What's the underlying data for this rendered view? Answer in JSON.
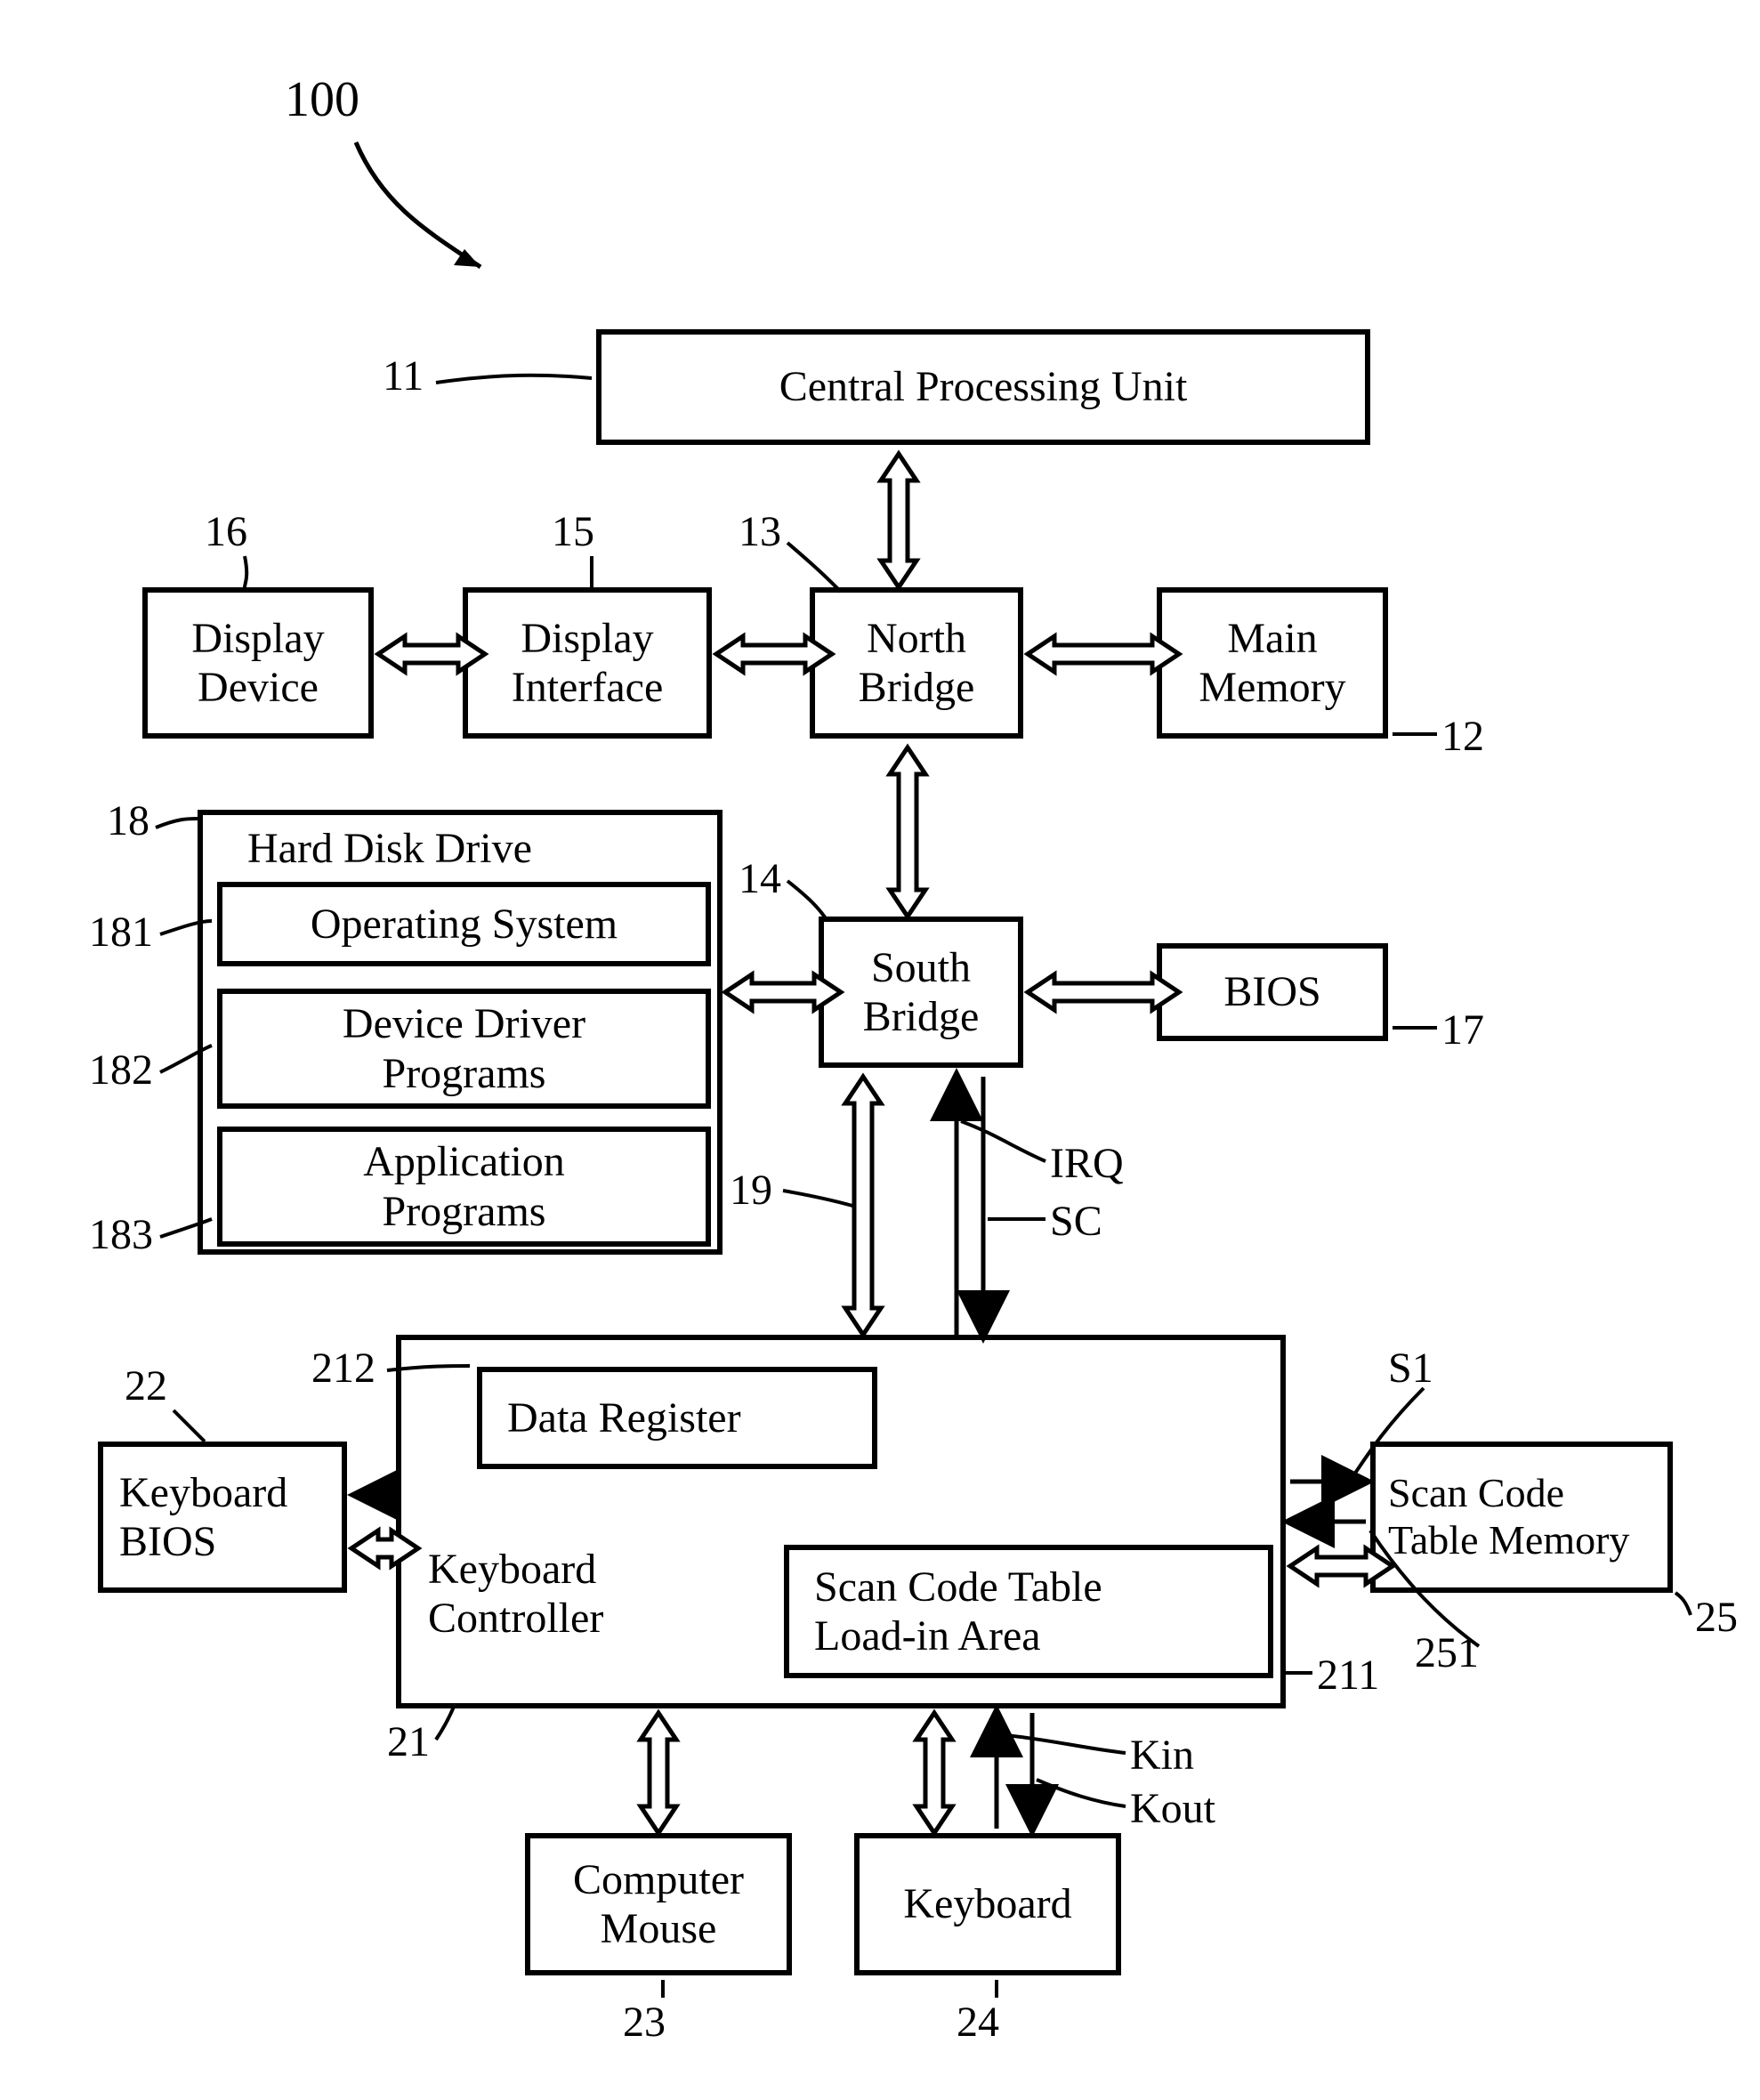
{
  "figure_ref": "100",
  "blocks": {
    "cpu": {
      "ref": "11",
      "label": "Central Processing Unit"
    },
    "main_memory": {
      "ref": "12",
      "label": "Main\nMemory"
    },
    "north_bridge": {
      "ref": "13",
      "label": "North\nBridge"
    },
    "south_bridge": {
      "ref": "14",
      "label": "South\nBridge"
    },
    "display_if": {
      "ref": "15",
      "label": "Display\nInterface"
    },
    "display_dev": {
      "ref": "16",
      "label": "Display\nDevice"
    },
    "bios": {
      "ref": "17",
      "label": "BIOS"
    },
    "hdd": {
      "ref": "18",
      "label": "Hard Disk Drive"
    },
    "hdd_os": {
      "ref": "181",
      "label": "Operating System"
    },
    "hdd_drv": {
      "ref": "182",
      "label": "Device Driver\nPrograms"
    },
    "hdd_app": {
      "ref": "183",
      "label": "Application\nPrograms"
    },
    "bus": {
      "ref": "19"
    },
    "kbc": {
      "ref": "21",
      "label": "Keyboard\nController"
    },
    "kbc_loadin": {
      "ref": "211",
      "label": "Scan Code Table\nLoad-in Area"
    },
    "kbc_datareg": {
      "ref": "212",
      "label": "Data Register"
    },
    "kb_bios": {
      "ref": "22",
      "label": "Keyboard\nBIOS"
    },
    "mouse": {
      "ref": "23",
      "label": "Computer\nMouse"
    },
    "keyboard": {
      "ref": "24",
      "label": "Keyboard"
    },
    "sct_mem": {
      "ref": "25",
      "label": "Scan Code\nTable Memory"
    },
    "sct_mem_inner": {
      "ref": "251"
    }
  },
  "signals": {
    "irq": "IRQ",
    "sc": "SC",
    "s1": "S1",
    "kin": "Kin",
    "kout": "Kout"
  }
}
